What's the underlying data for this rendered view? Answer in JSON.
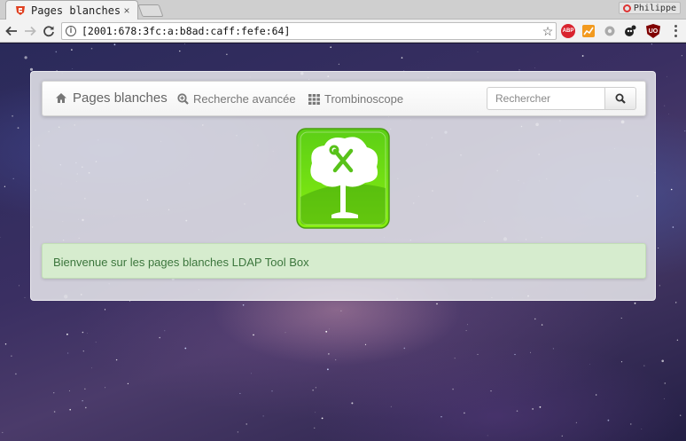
{
  "browser": {
    "tab_title": "Pages blanches",
    "tab_close": "×",
    "profile_name": "Philippe",
    "url": "[2001:678:3fc:a:b8ad:caff:fefe:64]",
    "extensions": {
      "abp_label": "ABP",
      "ublock_label": "UO"
    }
  },
  "nav": {
    "brand": "Pages blanches",
    "links": [
      {
        "label": "Recherche avancée",
        "icon": "zoom-in-icon"
      },
      {
        "label": "Trombinoscope",
        "icon": "grid-icon"
      }
    ],
    "search_placeholder": "Rechercher"
  },
  "alert": {
    "message": "Bienvenue sur les pages blanches LDAP Tool Box"
  },
  "colors": {
    "alert_bg": "#d6ecce",
    "alert_text": "#3c763d",
    "logo_green": "#76d819",
    "nav_text": "#777777"
  }
}
